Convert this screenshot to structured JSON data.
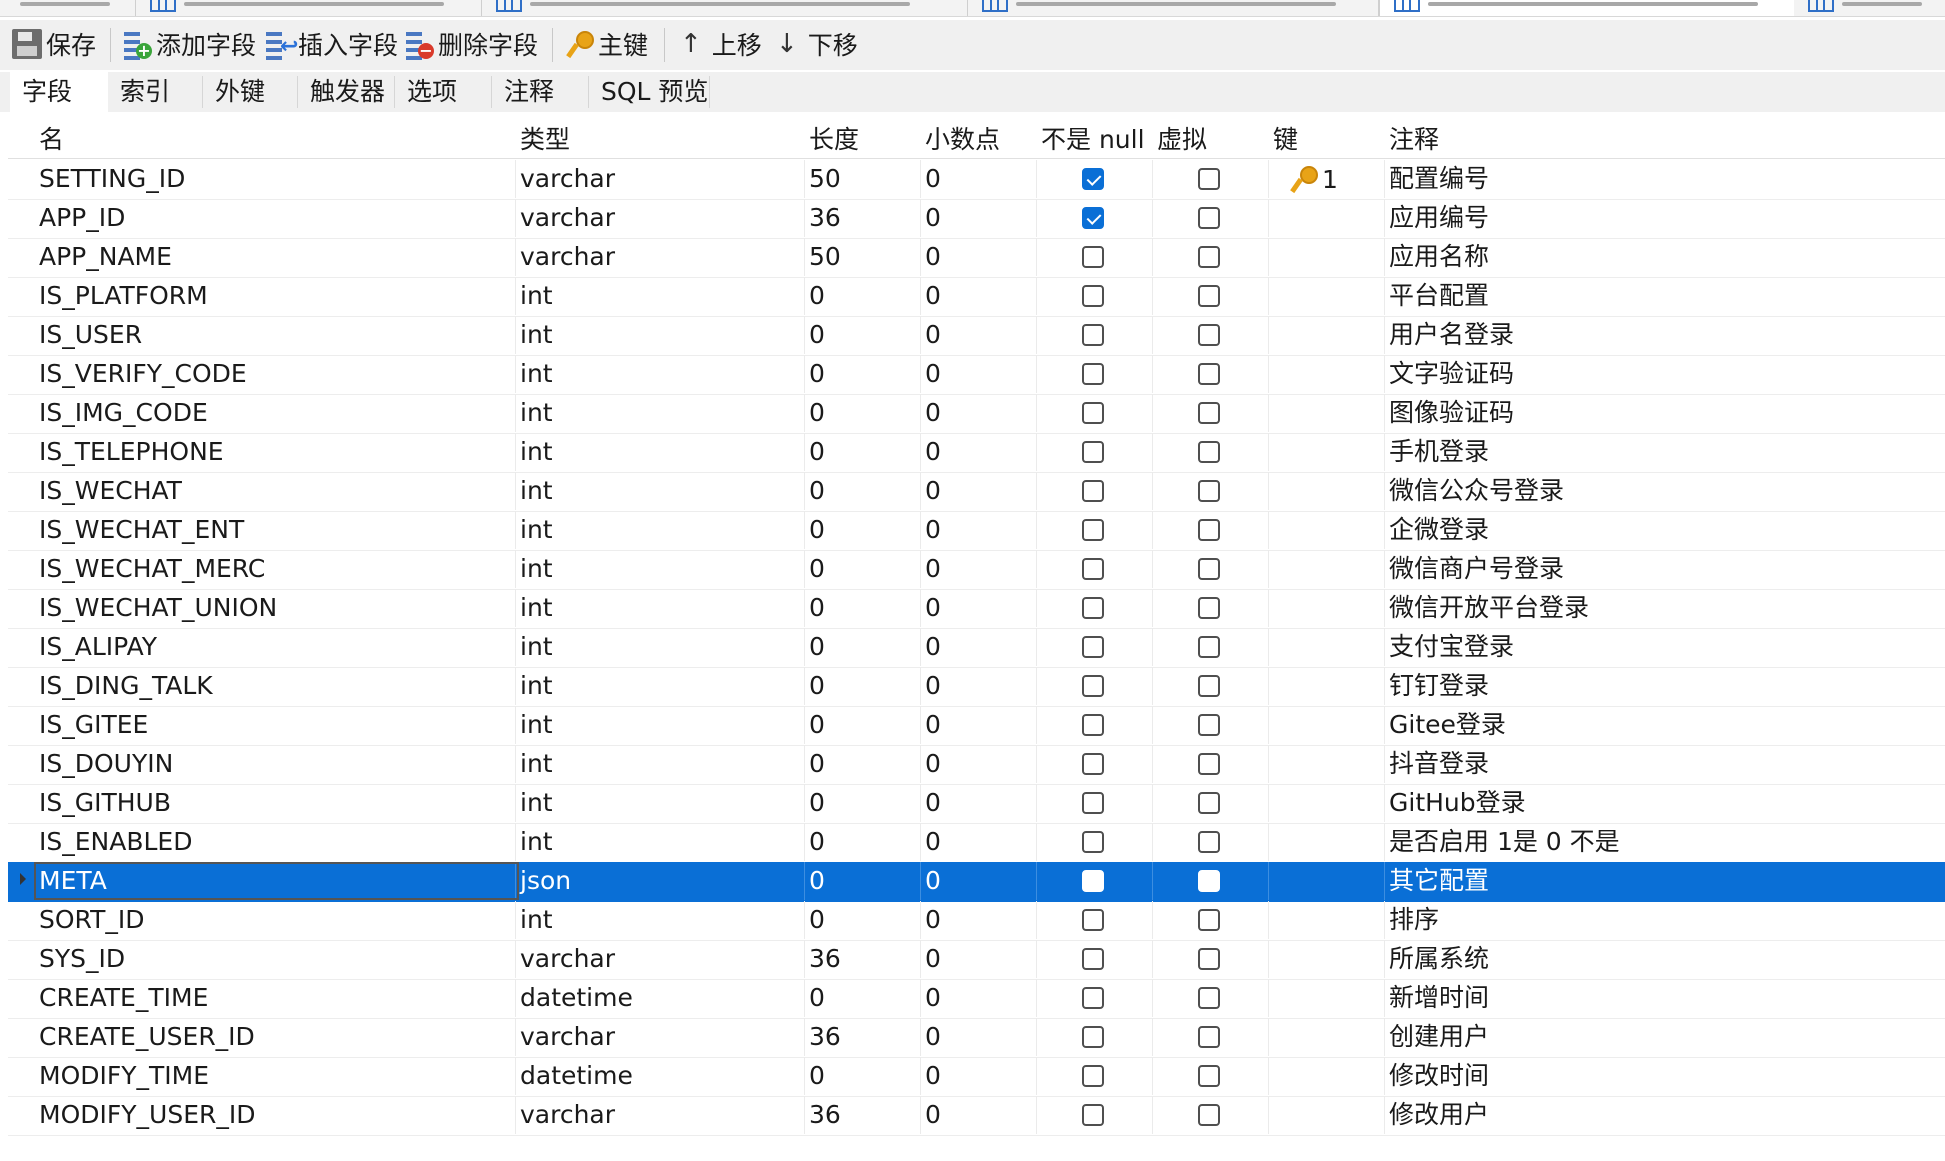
{
  "toolbar": {
    "save": "保存",
    "add_field": "添加字段",
    "insert_field": "插入字段",
    "delete_field": "删除字段",
    "primary_key": "主键",
    "move_up": "上移",
    "move_down": "下移"
  },
  "subtabs": [
    "字段",
    "索引",
    "外键",
    "触发器",
    "选项",
    "注释",
    "SQL 预览"
  ],
  "active_subtab": "字段",
  "columns": [
    "名",
    "类型",
    "长度",
    "小数点",
    "不是 null",
    "虚拟",
    "键",
    "注释"
  ],
  "rows": [
    {
      "name": "SETTING_ID",
      "type": "varchar",
      "length": "50",
      "decimals": "0",
      "not_null": true,
      "virtual": false,
      "key": "1",
      "comment": "配置编号"
    },
    {
      "name": "APP_ID",
      "type": "varchar",
      "length": "36",
      "decimals": "0",
      "not_null": true,
      "virtual": false,
      "key": "",
      "comment": "应用编号"
    },
    {
      "name": "APP_NAME",
      "type": "varchar",
      "length": "50",
      "decimals": "0",
      "not_null": false,
      "virtual": false,
      "key": "",
      "comment": "应用名称"
    },
    {
      "name": "IS_PLATFORM",
      "type": "int",
      "length": "0",
      "decimals": "0",
      "not_null": false,
      "virtual": false,
      "key": "",
      "comment": "平台配置"
    },
    {
      "name": "IS_USER",
      "type": "int",
      "length": "0",
      "decimals": "0",
      "not_null": false,
      "virtual": false,
      "key": "",
      "comment": "用户名登录"
    },
    {
      "name": "IS_VERIFY_CODE",
      "type": "int",
      "length": "0",
      "decimals": "0",
      "not_null": false,
      "virtual": false,
      "key": "",
      "comment": "文字验证码"
    },
    {
      "name": "IS_IMG_CODE",
      "type": "int",
      "length": "0",
      "decimals": "0",
      "not_null": false,
      "virtual": false,
      "key": "",
      "comment": "图像验证码"
    },
    {
      "name": "IS_TELEPHONE",
      "type": "int",
      "length": "0",
      "decimals": "0",
      "not_null": false,
      "virtual": false,
      "key": "",
      "comment": "手机登录"
    },
    {
      "name": "IS_WECHAT",
      "type": "int",
      "length": "0",
      "decimals": "0",
      "not_null": false,
      "virtual": false,
      "key": "",
      "comment": "微信公众号登录"
    },
    {
      "name": "IS_WECHAT_ENT",
      "type": "int",
      "length": "0",
      "decimals": "0",
      "not_null": false,
      "virtual": false,
      "key": "",
      "comment": "企微登录"
    },
    {
      "name": "IS_WECHAT_MERC",
      "type": "int",
      "length": "0",
      "decimals": "0",
      "not_null": false,
      "virtual": false,
      "key": "",
      "comment": "微信商户号登录"
    },
    {
      "name": "IS_WECHAT_UNION",
      "type": "int",
      "length": "0",
      "decimals": "0",
      "not_null": false,
      "virtual": false,
      "key": "",
      "comment": "微信开放平台登录"
    },
    {
      "name": "IS_ALIPAY",
      "type": "int",
      "length": "0",
      "decimals": "0",
      "not_null": false,
      "virtual": false,
      "key": "",
      "comment": "支付宝登录"
    },
    {
      "name": "IS_DING_TALK",
      "type": "int",
      "length": "0",
      "decimals": "0",
      "not_null": false,
      "virtual": false,
      "key": "",
      "comment": "钉钉登录"
    },
    {
      "name": "IS_GITEE",
      "type": "int",
      "length": "0",
      "decimals": "0",
      "not_null": false,
      "virtual": false,
      "key": "",
      "comment": "Gitee登录"
    },
    {
      "name": "IS_DOUYIN",
      "type": "int",
      "length": "0",
      "decimals": "0",
      "not_null": false,
      "virtual": false,
      "key": "",
      "comment": "抖音登录"
    },
    {
      "name": "IS_GITHUB",
      "type": "int",
      "length": "0",
      "decimals": "0",
      "not_null": false,
      "virtual": false,
      "key": "",
      "comment": "GitHub登录"
    },
    {
      "name": "IS_ENABLED",
      "type": "int",
      "length": "0",
      "decimals": "0",
      "not_null": false,
      "virtual": false,
      "key": "",
      "comment": "是否启用 1是 0 不是"
    },
    {
      "name": "META",
      "type": "json",
      "length": "0",
      "decimals": "0",
      "not_null": false,
      "virtual": false,
      "key": "",
      "comment": "其它配置",
      "selected": true
    },
    {
      "name": "SORT_ID",
      "type": "int",
      "length": "0",
      "decimals": "0",
      "not_null": false,
      "virtual": false,
      "key": "",
      "comment": "排序"
    },
    {
      "name": "SYS_ID",
      "type": "varchar",
      "length": "36",
      "decimals": "0",
      "not_null": false,
      "virtual": false,
      "key": "",
      "comment": "所属系统"
    },
    {
      "name": "CREATE_TIME",
      "type": "datetime",
      "length": "0",
      "decimals": "0",
      "not_null": false,
      "virtual": false,
      "key": "",
      "comment": "新增时间"
    },
    {
      "name": "CREATE_USER_ID",
      "type": "varchar",
      "length": "36",
      "decimals": "0",
      "not_null": false,
      "virtual": false,
      "key": "",
      "comment": "创建用户"
    },
    {
      "name": "MODIFY_TIME",
      "type": "datetime",
      "length": "0",
      "decimals": "0",
      "not_null": false,
      "virtual": false,
      "key": "",
      "comment": "修改时间"
    },
    {
      "name": "MODIFY_USER_ID",
      "type": "varchar",
      "length": "36",
      "decimals": "0",
      "not_null": false,
      "virtual": false,
      "key": "",
      "comment": "修改用户"
    }
  ],
  "colors": {
    "selection": "#0a6fd6",
    "checkbox_checked": "#0a6fd6",
    "key_icon": "#e8a317",
    "toolbar_bg": "#f0f0f0"
  }
}
